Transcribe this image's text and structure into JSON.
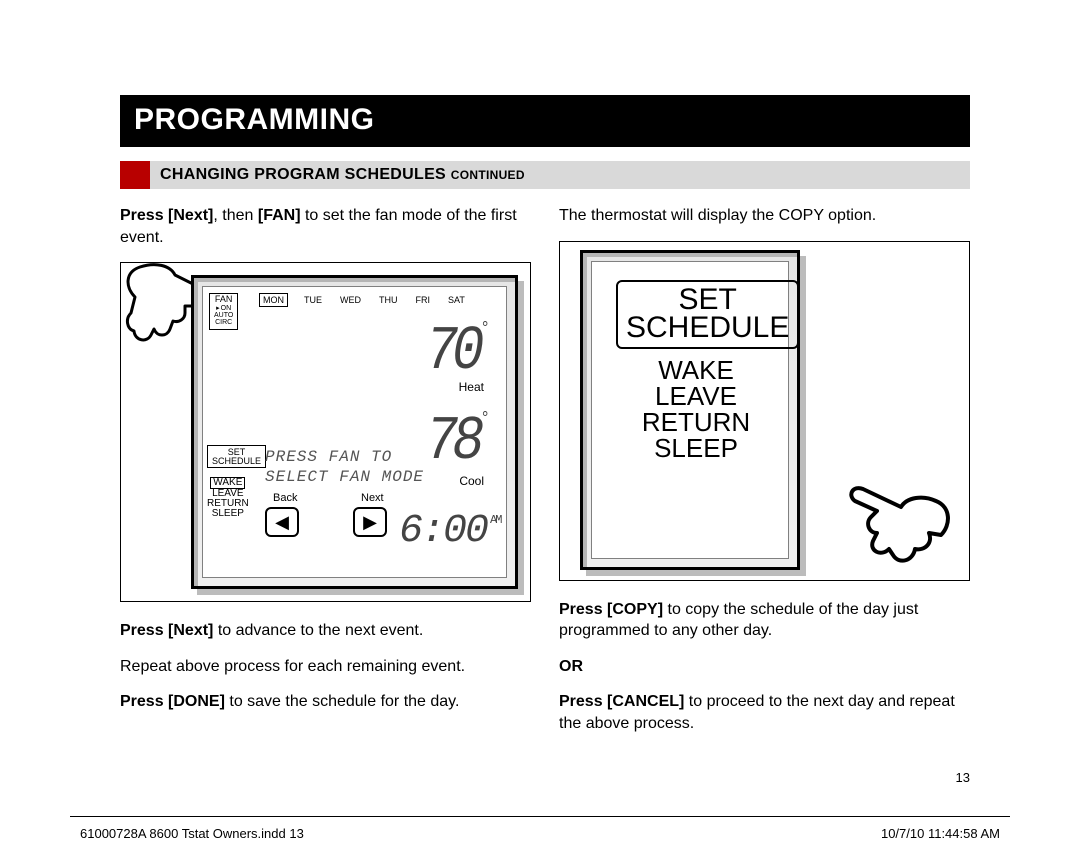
{
  "header": {
    "section": "PROGRAMMING",
    "subsection": "CHANGING PROGRAM SCHEDULES",
    "subsection_suffix": "CONTINUED"
  },
  "col_left": {
    "p1_a": "Press [Next]",
    "p1_b": ", then ",
    "p1_c": "[FAN]",
    "p1_d": " to set the fan mode of the first event.",
    "p2_a": "Press [Next]",
    "p2_b": " to advance to the next event.",
    "p3": "Repeat above process for each remaining event.",
    "p4_a": "Press [DONE]",
    "p4_b": " to save the schedule for the day."
  },
  "col_right": {
    "p1": "The thermostat will display the COPY option.",
    "p2_a": "Press [COPY]",
    "p2_b": " to copy the schedule of the day just programmed to any other day.",
    "or": "OR",
    "p3_a": "Press [CANCEL]",
    "p3_b": " to proceed to the next day and repeat the above process."
  },
  "lcd1": {
    "fan_label": "FAN",
    "fan_opts": [
      "ON",
      "AUTO",
      "CIRC"
    ],
    "days": [
      "MON",
      "TUE",
      "WED",
      "THU",
      "FRI",
      "SAT"
    ],
    "heat_temp": "70",
    "heat_label": "Heat",
    "cool_temp": "78",
    "cool_label": "Cool",
    "set": "SET",
    "schedule": "SCHEDULE",
    "events": [
      "WAKE",
      "LEAVE",
      "RETURN",
      "SLEEP"
    ],
    "msg_line1": "PRESS FAN TO",
    "msg_line2": "SELECT FAN MODE",
    "back": "Back",
    "next": "Next",
    "time": "6:00",
    "ampm": "AM"
  },
  "lcd2": {
    "set": "SET",
    "schedule": "SCHEDULE",
    "events": [
      "WAKE",
      "LEAVE",
      "RETURN",
      "SLEEP"
    ]
  },
  "page_number": "13",
  "footer": {
    "left": "61000728A 8600 Tstat Owners.indd   13",
    "right": "10/7/10   11:44:58 AM"
  }
}
